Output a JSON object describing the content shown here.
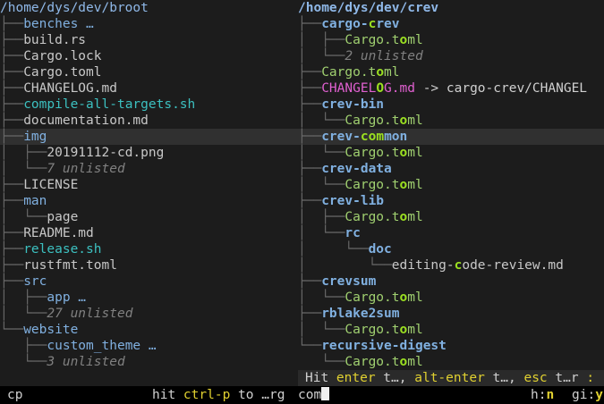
{
  "left_panel": {
    "root_path": "/home/dys/dev/broot",
    "entries": [
      {
        "prefix": "├──",
        "name": "benches …",
        "kind": "dir"
      },
      {
        "prefix": "├──",
        "name": "build.rs",
        "kind": "text"
      },
      {
        "prefix": "├──",
        "name": "Cargo.lock",
        "kind": "text"
      },
      {
        "prefix": "├──",
        "name": "Cargo.toml",
        "kind": "text"
      },
      {
        "prefix": "├──",
        "name": "CHANGELOG.md",
        "kind": "text"
      },
      {
        "prefix": "├──",
        "name": "compile-all-targets.sh",
        "kind": "exec"
      },
      {
        "prefix": "├──",
        "name": "documentation.md",
        "kind": "text"
      },
      {
        "prefix": "├──",
        "name": "img",
        "kind": "dir",
        "selected": true
      },
      {
        "prefix": "│  ├──",
        "name": "20191112-cd.png",
        "kind": "text"
      },
      {
        "prefix": "│  └──",
        "name": "7 unlisted",
        "kind": "unlisted"
      },
      {
        "prefix": "├──",
        "name": "LICENSE",
        "kind": "text"
      },
      {
        "prefix": "├──",
        "name": "man",
        "kind": "dir"
      },
      {
        "prefix": "│  └──",
        "name": "page",
        "kind": "text"
      },
      {
        "prefix": "├──",
        "name": "README.md",
        "kind": "text"
      },
      {
        "prefix": "├──",
        "name": "release.sh",
        "kind": "exec"
      },
      {
        "prefix": "├──",
        "name": "rustfmt.toml",
        "kind": "text"
      },
      {
        "prefix": "├──",
        "name": "src",
        "kind": "dir"
      },
      {
        "prefix": "│  ├──",
        "name": "app …",
        "kind": "dir"
      },
      {
        "prefix": "│  └──",
        "name": "27 unlisted",
        "kind": "unlisted"
      },
      {
        "prefix": "└──",
        "name": "website",
        "kind": "dir"
      },
      {
        "prefix": "   ├──",
        "name": "custom_theme …",
        "kind": "dir"
      },
      {
        "prefix": "   └──",
        "name": "3 unlisted",
        "kind": "unlisted"
      }
    ]
  },
  "right_panel": {
    "root_path": "/home/dys/dev/crev",
    "entries": [
      {
        "prefix": "├──",
        "parts": [
          {
            "t": "cargo-",
            "c": "dirb"
          },
          {
            "t": "c",
            "c": "hl"
          },
          {
            "t": "rev",
            "c": "dirb"
          }
        ]
      },
      {
        "prefix": "│  ├──",
        "parts": [
          {
            "t": "Cargo.t",
            "c": "file"
          },
          {
            "t": "o",
            "c": "hl"
          },
          {
            "t": "ml",
            "c": "file"
          }
        ]
      },
      {
        "prefix": "│  └──",
        "parts": [
          {
            "t": "2 unlisted",
            "c": "unl"
          }
        ]
      },
      {
        "prefix": "├──",
        "parts": [
          {
            "t": "Cargo.t",
            "c": "file"
          },
          {
            "t": "o",
            "c": "hl"
          },
          {
            "t": "ml",
            "c": "file"
          }
        ]
      },
      {
        "prefix": "├──",
        "parts": [
          {
            "t": "CHANGEL",
            "c": "link"
          },
          {
            "t": "O",
            "c": "hl"
          },
          {
            "t": "G.md",
            "c": "link"
          },
          {
            "t": " -> cargo-crev/CHANGEL",
            "c": "arrow"
          }
        ]
      },
      {
        "prefix": "├──",
        "parts": [
          {
            "t": "crev-bin",
            "c": "dirb"
          }
        ]
      },
      {
        "prefix": "│  └──",
        "parts": [
          {
            "t": "Cargo.t",
            "c": "file"
          },
          {
            "t": "o",
            "c": "hl"
          },
          {
            "t": "ml",
            "c": "file"
          }
        ]
      },
      {
        "prefix": "├──",
        "selected": true,
        "parts": [
          {
            "t": "crev-",
            "c": "dirb"
          },
          {
            "t": "com",
            "c": "hl"
          },
          {
            "t": "mon",
            "c": "dirb"
          }
        ]
      },
      {
        "prefix": "│  └──",
        "parts": [
          {
            "t": "Cargo.t",
            "c": "file"
          },
          {
            "t": "o",
            "c": "hl"
          },
          {
            "t": "ml",
            "c": "file"
          }
        ]
      },
      {
        "prefix": "├──",
        "parts": [
          {
            "t": "crev-data",
            "c": "dirb"
          }
        ]
      },
      {
        "prefix": "│  └──",
        "parts": [
          {
            "t": "Cargo.t",
            "c": "file"
          },
          {
            "t": "o",
            "c": "hl"
          },
          {
            "t": "ml",
            "c": "file"
          }
        ]
      },
      {
        "prefix": "├──",
        "parts": [
          {
            "t": "crev-lib",
            "c": "dirb"
          }
        ]
      },
      {
        "prefix": "│  ├──",
        "parts": [
          {
            "t": "Cargo.t",
            "c": "file"
          },
          {
            "t": "o",
            "c": "hl"
          },
          {
            "t": "ml",
            "c": "file"
          }
        ]
      },
      {
        "prefix": "│  └──",
        "parts": [
          {
            "t": "rc",
            "c": "dirb"
          }
        ]
      },
      {
        "prefix": "│     └──",
        "parts": [
          {
            "t": "doc",
            "c": "dirb"
          }
        ]
      },
      {
        "prefix": "│        └──",
        "parts": [
          {
            "t": "editing-",
            "c": "text"
          },
          {
            "t": "c",
            "c": "hl"
          },
          {
            "t": "ode-review.md",
            "c": "text"
          }
        ]
      },
      {
        "prefix": "├──",
        "parts": [
          {
            "t": "crevsum",
            "c": "dirb"
          }
        ]
      },
      {
        "prefix": "│  └──",
        "parts": [
          {
            "t": "Cargo.t",
            "c": "file"
          },
          {
            "t": "o",
            "c": "hl"
          },
          {
            "t": "ml",
            "c": "file"
          }
        ]
      },
      {
        "prefix": "├──",
        "parts": [
          {
            "t": "rblake2sum",
            "c": "dirb"
          }
        ]
      },
      {
        "prefix": "│  └──",
        "parts": [
          {
            "t": "Cargo.t",
            "c": "file"
          },
          {
            "t": "o",
            "c": "hl"
          },
          {
            "t": "ml",
            "c": "file"
          }
        ]
      },
      {
        "prefix": "└──",
        "parts": [
          {
            "t": "recursive-digest",
            "c": "dirb"
          }
        ]
      },
      {
        "prefix": "   └──",
        "parts": [
          {
            "t": "Cargo.t",
            "c": "file"
          },
          {
            "t": "o",
            "c": "hl"
          },
          {
            "t": "ml",
            "c": "file"
          }
        ]
      }
    ]
  },
  "help_bar": {
    "parts": [
      {
        "t": "Hit ",
        "c": "w"
      },
      {
        "t": "enter",
        "c": "y"
      },
      {
        "t": " t…, ",
        "c": "w"
      },
      {
        "t": "alt-enter",
        "c": "y"
      },
      {
        "t": " t…, ",
        "c": "w"
      },
      {
        "t": "esc",
        "c": "y"
      },
      {
        "t": " t…r ",
        "c": "w"
      },
      {
        "t": ":",
        "c": "y"
      }
    ]
  },
  "status_bar": {
    "left_input": "cp",
    "hint_pre": "hit ",
    "hint_key": "ctrl-p",
    "hint_post": " to …rg",
    "input_value": "com",
    "flag_h_label": "h:",
    "flag_h_value": "n",
    "flag_gi_label": "gi:",
    "flag_gi_value": "y"
  }
}
